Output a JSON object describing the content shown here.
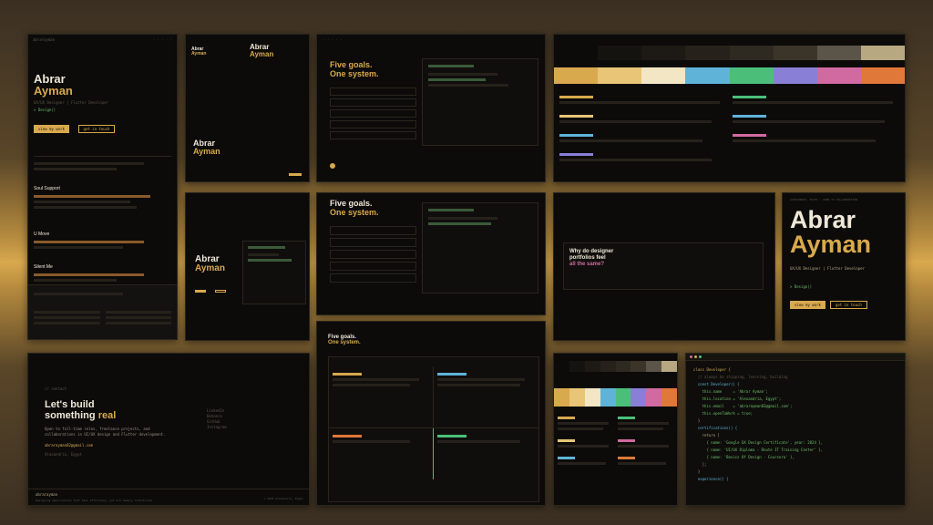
{
  "portfolio": {
    "first_name": "Abrar",
    "last_name": "Ayman",
    "role": "UX/UX Designer | Flutter Developer",
    "tagline": "> Design()",
    "location": "ALEXANDRIA, EGYPT - OPEN TO COLLABORATION",
    "cta_primary": "view my work",
    "cta_secondary": "get in touch"
  },
  "goals": {
    "heading_line1": "Five goals.",
    "heading_line2": "One system."
  },
  "projects": [
    "Soul Support",
    "U Move",
    "Silent Me"
  ],
  "question": {
    "line1": "Why do designer",
    "line2": "portfolios feel",
    "line3": "all the same?"
  },
  "contact": {
    "label": "// contact",
    "heading_line1": "Let's build",
    "heading_line2": "something",
    "heading_accent": "real",
    "intro": "Open to full-time roles, freelance projects, and collaborations in UI/UX design and Flutter development.",
    "email": "abrarayman82@gmail.com",
    "location": "Alexandria, Egypt",
    "links": [
      "LinkedIn",
      "Behance",
      "GitHub",
      "Instagram"
    ],
    "footer_name": "abrarayman",
    "footer_quote": "Designing applications that feel effortless, yet are deeply intentional.",
    "footer_year": "© 2025 Alexandria, Egypt"
  },
  "palette_top": {
    "colors": [
      "#d9a94e",
      "#e8c577",
      "#f2e6c4",
      "#5fb3d8",
      "#4bbf7a",
      "#8a7fd6",
      "#d06aa0",
      "#e0783a"
    ],
    "grays": [
      "#0c0b0a",
      "#151310",
      "#1d1a15",
      "#26221b",
      "#2f2a21",
      "#3b3428",
      "#5b5448",
      "#b8a882"
    ]
  },
  "palette_bottom": {
    "colors": [
      "#d9a94e",
      "#e8c577",
      "#f2e6c4",
      "#5fb3d8",
      "#4bbf7a",
      "#8a7fd6",
      "#d06aa0",
      "#e0783a"
    ],
    "grays": [
      "#0c0b0a",
      "#151310",
      "#1d1a15",
      "#26221b",
      "#2f2a21",
      "#3b3428",
      "#5b5448",
      "#b8a882"
    ]
  },
  "code": {
    "lines": [
      "class Developer {",
      "",
      "  // always be shipping, learning, building",
      "",
      "  const Developer() {",
      "    this.name     = 'Abrar Ayman';",
      "    this.location = 'Alexandria, Egypt';",
      "    this.email    = 'abrarayman82@gmail.com';",
      "    this.openToWork = true;",
      "  }",
      "",
      "  certifications() {",
      "    return [",
      "      { name: 'Google UX Design Certificate', year: 2024 },",
      "      { name: 'UI/UX Diploma - Route IT Training Center' },",
      "      { name: 'Basics Of Design - Coursera' },",
      "    ];",
      "  }",
      "",
      "  experience() {",
      "    return 'Turning user needs into intuitive designs - and bringing them to life with code';",
      "  }",
      "}"
    ]
  },
  "colors": {
    "accent": "#d9a94e",
    "background": "#0c0b0a",
    "accent_green": "#6fbf6a"
  }
}
